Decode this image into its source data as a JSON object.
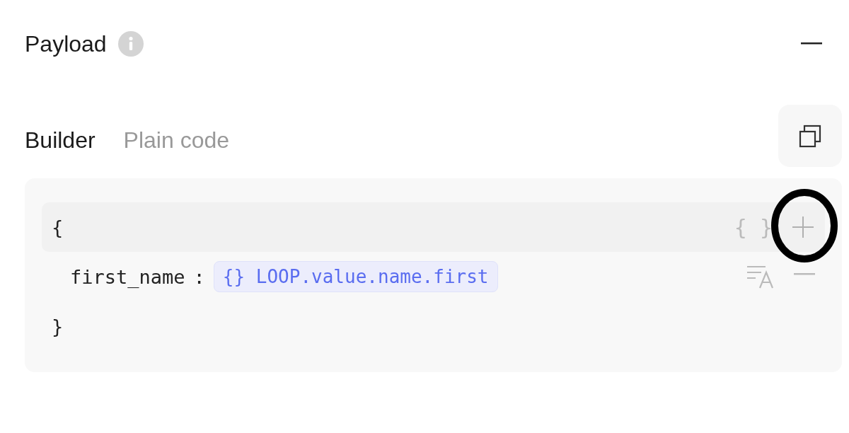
{
  "section": {
    "title": "Payload"
  },
  "tabs": [
    {
      "label": "Builder",
      "selected": true
    },
    {
      "label": "Plain code",
      "selected": false
    }
  ],
  "editor": {
    "open_brace": "{",
    "row_actions": {
      "braces": "{ }"
    },
    "fields": [
      {
        "key": "first_name",
        "separator": ":",
        "token_icon": "{}",
        "value": "LOOP.value.name.first"
      }
    ],
    "close_brace": "}"
  }
}
